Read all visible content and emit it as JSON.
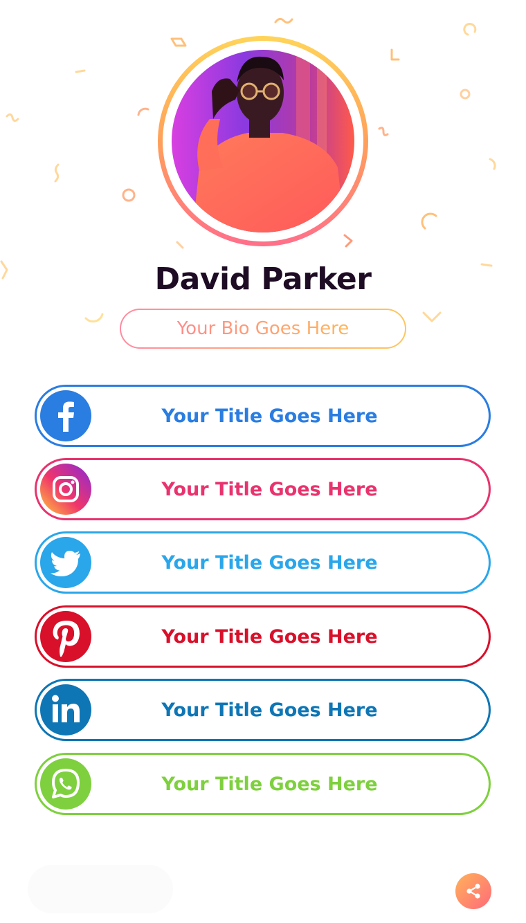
{
  "profile": {
    "name": "David Parker",
    "bio": "Your Bio Goes Here"
  },
  "links": [
    {
      "network": "facebook",
      "icon": "facebook-icon",
      "label": "Your Title Goes Here",
      "color": "#2a7de1"
    },
    {
      "network": "instagram",
      "icon": "instagram-icon",
      "label": "Your Title Goes Here",
      "color": "#e8336e"
    },
    {
      "network": "twitter",
      "icon": "twitter-icon",
      "label": "Your Title Goes Here",
      "color": "#2aa6ea"
    },
    {
      "network": "pinterest",
      "icon": "pinterest-icon",
      "label": "Your Title Goes Here",
      "color": "#d8102a"
    },
    {
      "network": "linkedin",
      "icon": "linkedin-icon",
      "label": "Your Title Goes Here",
      "color": "#0e76b5"
    },
    {
      "network": "whatsapp",
      "icon": "whatsapp-icon",
      "label": "Your Title Goes Here",
      "color": "#7ed03e"
    }
  ],
  "share": {
    "icon": "share-icon",
    "color": "#ff8a6a"
  },
  "colors": {
    "name": "#1e0b24",
    "accent_gradient_start": "#ffd45a",
    "accent_gradient_end": "#ff6f8a"
  }
}
